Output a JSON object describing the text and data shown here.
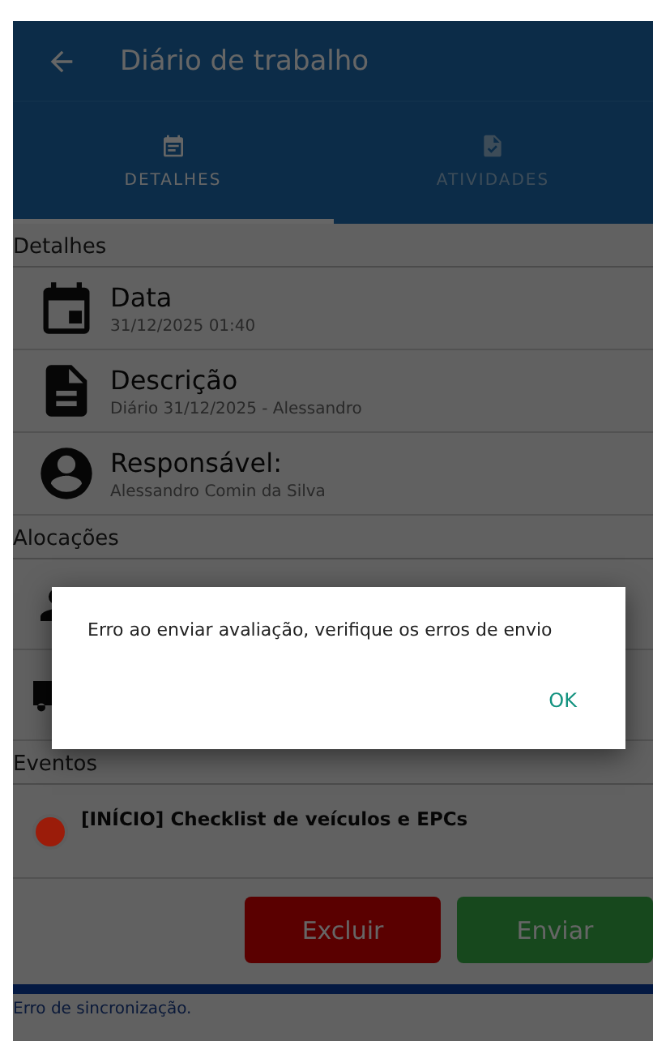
{
  "app_bar": {
    "title": "Diário de trabalho"
  },
  "tabs": [
    {
      "label": "DETALHES",
      "kind": "calendar",
      "selected": true
    },
    {
      "label": "ATIVIDADES",
      "kind": "document-check",
      "selected": false
    }
  ],
  "details": {
    "heading": "Detalhes",
    "rows": [
      {
        "kind": "calendar",
        "label": "Data",
        "value": "31/12/2025 01:40"
      },
      {
        "kind": "document",
        "label": "Descrição",
        "value": "Diário 31/12/2025 - Alessandro"
      },
      {
        "kind": "person",
        "label": "Responsável:",
        "value": "Alessandro Comin da Silva"
      }
    ]
  },
  "allocations": {
    "heading": "Alocações",
    "rows": [
      {
        "kind": "person"
      },
      {
        "kind": "truck"
      }
    ]
  },
  "events": {
    "heading": "Eventos",
    "items": [
      {
        "title": "[INÍCIO] Checklist de veículos e EPCs",
        "color": "#9b1c0a"
      }
    ]
  },
  "buttons": [
    {
      "label": "Excluir",
      "kind": "danger"
    },
    {
      "label": "Enviar",
      "kind": "success"
    }
  ],
  "status_bar": {
    "text": "Erro de sincronização."
  },
  "dialog": {
    "message": "Erro ao enviar avaliação, verifique os erros de envio",
    "buttons": [
      "OK"
    ]
  }
}
